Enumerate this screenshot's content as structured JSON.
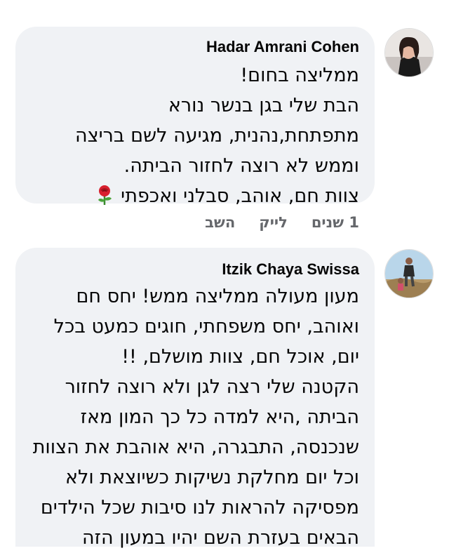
{
  "comments": [
    {
      "author": "Hadar Amrani Cohen",
      "lines": [
        "ממליצה בחום!",
        "הבת שלי בגן בנשר נורא",
        "מתפתחת,נהנית, מגיעה לשם בריצה",
        "וממש לא רוצה לחזור הביתה.",
        "צוות חם, אוהב, סבלני ואכפתי"
      ],
      "emoji": "rose",
      "time": "1 שנים",
      "like_label": "לייק",
      "reply_label": "השב"
    },
    {
      "author": "Itzik Chaya Swissa",
      "lines": [
        "מעון מעולה ממליצה ממש! יחס חם",
        "ואוהב, יחס משפחתי, חוגים כמעט בכל",
        "יום, אוכל חם, צוות מושלם, !!",
        "הקטנה שלי רצה לגן ולא רוצה לחזור",
        "הביתה ,היא למדה כל כך המון מאז",
        "שנכנסה, התבגרה, היא אוהבת את הצוות",
        "וכל יום מחלקת נשיקות כשיוצאת ולא",
        "מפסיקה להראות לנו סיבות שכל הילדים",
        "הבאים בעזרת השם יהיו במעון הזה"
      ]
    }
  ],
  "colors": {
    "bubble": "#f0f2f5",
    "text": "#050505",
    "meta": "#65676b"
  }
}
